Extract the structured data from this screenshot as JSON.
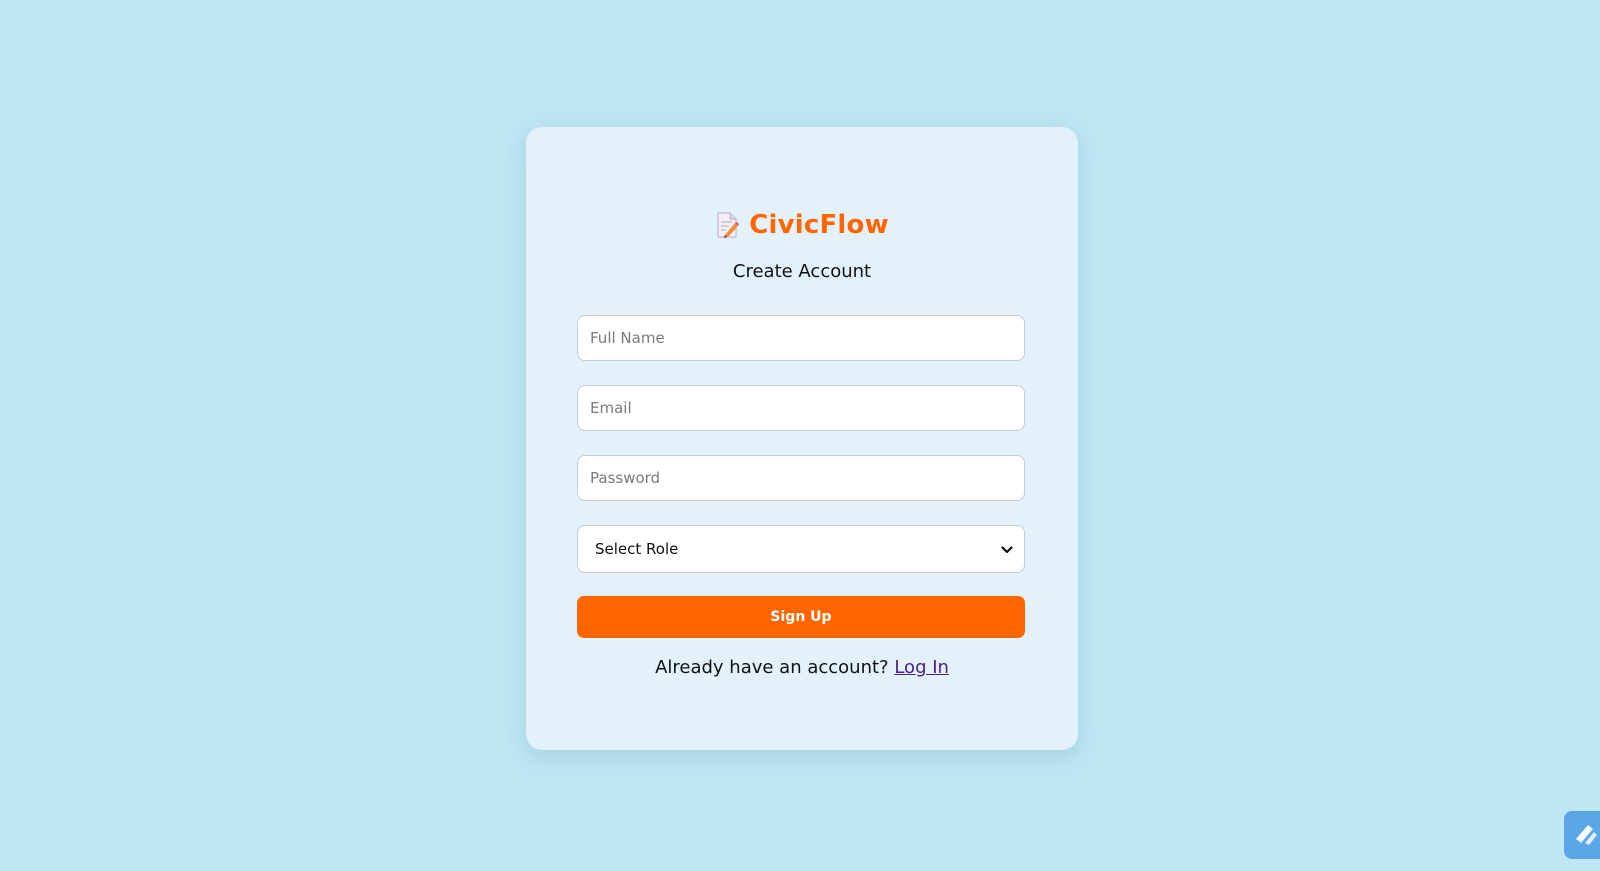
{
  "brand": {
    "name": "CivicFlow",
    "icon": "memo-icon",
    "color": "#ff6600"
  },
  "form": {
    "title": "Create Account",
    "full_name": {
      "placeholder": "Full Name",
      "value": ""
    },
    "email": {
      "placeholder": "Email",
      "value": ""
    },
    "password": {
      "placeholder": "Password",
      "value": ""
    },
    "role": {
      "selected": "Select Role"
    },
    "submit_label": "Sign Up",
    "footer_text": "Already have an account?",
    "login_link": "Log In"
  },
  "colors": {
    "background": "#bee6f3",
    "card": "#e3f1fc",
    "accent": "#ff6600",
    "link": "#4b2286"
  }
}
